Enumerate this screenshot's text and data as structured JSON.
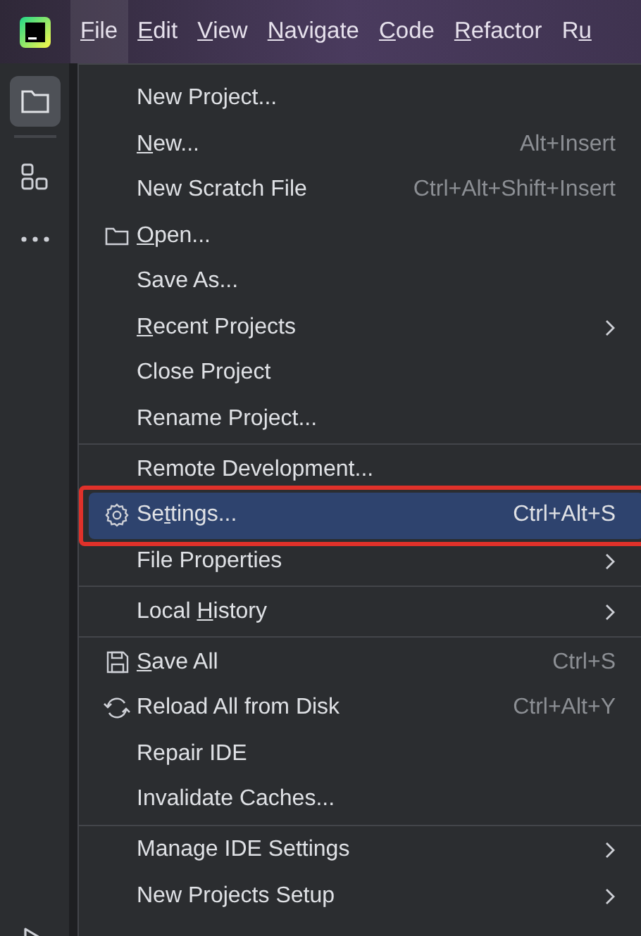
{
  "menubar": [
    {
      "mnemonic": "F",
      "after": "ile",
      "selected": true
    },
    {
      "mnemonic": "E",
      "after": "dit",
      "selected": false
    },
    {
      "mnemonic": "V",
      "after": "iew",
      "selected": false
    },
    {
      "mnemonic": "N",
      "after": "avigate",
      "selected": false
    },
    {
      "mnemonic": "C",
      "after": "ode",
      "selected": false
    },
    {
      "mnemonic": "R",
      "after": "efactor",
      "selected": false
    },
    {
      "before": "R",
      "mnemonic": "u",
      "selected": false
    }
  ],
  "toolbar": [
    {
      "kind": "folder",
      "selected": true
    },
    {
      "kind": "structure",
      "selected": false
    },
    {
      "kind": "more",
      "selected": false
    }
  ],
  "toolbar_bottom": [
    {
      "kind": "run",
      "selected": false
    }
  ],
  "file_menu": {
    "sections": [
      [
        {
          "before": "New Project...",
          "selected": false,
          "submenu": false
        },
        {
          "mnemonic": "N",
          "after": "ew...",
          "shortcut": "Alt+Insert",
          "selected": false,
          "submenu": false
        },
        {
          "before": "New Scratch File",
          "shortcut": "Ctrl+Alt+Shift+Insert",
          "selected": false,
          "submenu": false
        },
        {
          "mnemonic": "O",
          "after": "pen...",
          "kind": "folder",
          "selected": false,
          "submenu": false
        },
        {
          "before": "Save As...",
          "selected": false,
          "submenu": false
        },
        {
          "mnemonic": "R",
          "after": "ecent Projects",
          "selected": false,
          "submenu": true
        },
        {
          "before": "Close Project",
          "selected": false,
          "submenu": false
        },
        {
          "before": "Rename Project...",
          "selected": false,
          "submenu": false
        }
      ],
      [
        {
          "before": "Remote Development...",
          "selected": false,
          "submenu": false
        },
        {
          "before": "Se",
          "mnemonic": "t",
          "after": "tings...",
          "shortcut": "Ctrl+Alt+S",
          "kind": "gear",
          "selected": true,
          "annotated": true,
          "submenu": false
        },
        {
          "before": "File Properties",
          "selected": false,
          "submenu": true
        }
      ],
      [
        {
          "before": "Local ",
          "mnemonic": "H",
          "after": "istory",
          "selected": false,
          "submenu": true
        }
      ],
      [
        {
          "mnemonic": "S",
          "after": "ave All",
          "shortcut": "Ctrl+S",
          "kind": "save",
          "selected": false,
          "submenu": false
        },
        {
          "before": "Reload All from Disk",
          "shortcut": "Ctrl+Alt+Y",
          "kind": "reload",
          "selected": false,
          "submenu": false
        },
        {
          "before": "Repair IDE",
          "selected": false,
          "submenu": false
        },
        {
          "before": "Invalidate Caches...",
          "selected": false,
          "submenu": false
        }
      ],
      [
        {
          "before": "Manage IDE Settings",
          "selected": false,
          "submenu": true
        },
        {
          "before": "New Projects Setup",
          "selected": false,
          "submenu": true
        }
      ]
    ]
  }
}
